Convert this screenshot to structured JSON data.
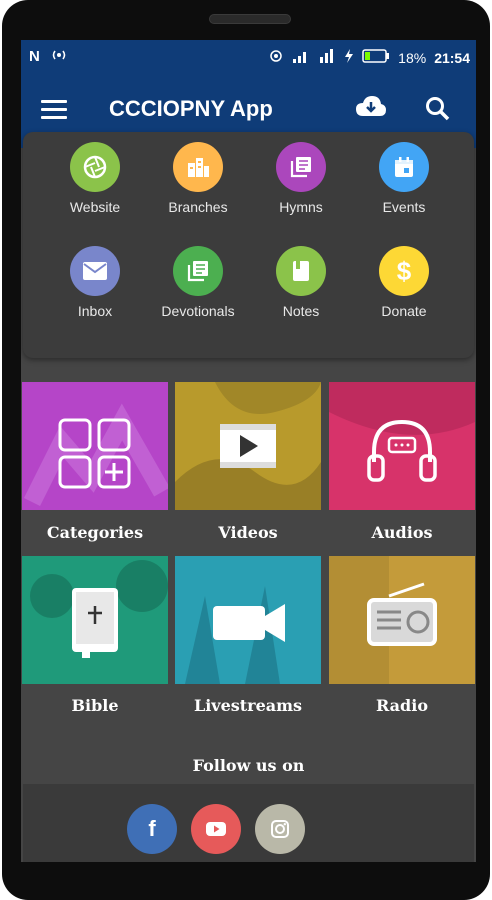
{
  "status_bar": {
    "left_icons": [
      "n-notification-icon",
      "radio-signal-icon"
    ],
    "right_icons": [
      "hotspot-icon",
      "signal-bars-icon",
      "mobile-data-icon",
      "charging-icon",
      "battery-icon"
    ],
    "battery": "18%",
    "time": "21:54"
  },
  "app_bar": {
    "title": "CCCIOPNY App",
    "icons": [
      "menu-icon",
      "cloud-download-icon",
      "search-icon"
    ]
  },
  "shortcuts": [
    {
      "label": "Website",
      "icon": "aperture-icon",
      "color": "#8bc34a"
    },
    {
      "label": "Branches",
      "icon": "city-icon",
      "color": "#ffb74d"
    },
    {
      "label": "Hymns",
      "icon": "library-books-icon",
      "color": "#ab47bc"
    },
    {
      "label": "Events",
      "icon": "calendar-icon",
      "color": "#42a5f5"
    },
    {
      "label": "Inbox",
      "icon": "mail-icon",
      "color": "#7986cb"
    },
    {
      "label": "Devotionals",
      "icon": "notes-list-icon",
      "color": "#4caf50"
    },
    {
      "label": "Notes",
      "icon": "book-icon",
      "color": "#8bc34a"
    },
    {
      "label": "Donate",
      "icon": "dollar-icon",
      "color": "#fdd835"
    }
  ],
  "tiles": [
    {
      "label": "Categories",
      "icon": "grid-plus-icon",
      "color": "#c34ad6"
    },
    {
      "label": "Videos",
      "icon": "video-player-icon",
      "color": "#b89a2c"
    },
    {
      "label": "Audios",
      "icon": "headphones-icon",
      "color": "#d7336a"
    },
    {
      "label": "Bible",
      "icon": "bible-icon",
      "color": "#1f9a7a"
    },
    {
      "label": "Livestreams",
      "icon": "video-camera-icon",
      "color": "#2a9fb3"
    },
    {
      "label": "Radio",
      "icon": "radio-icon",
      "color": "#c49b3a"
    }
  ],
  "follow": {
    "heading": "Follow us on",
    "socials": [
      {
        "name": "facebook",
        "icon": "facebook-icon",
        "glyph": "f",
        "color": "#3f6fb6"
      },
      {
        "name": "youtube",
        "icon": "youtube-icon",
        "color": "#e65a5a"
      },
      {
        "name": "instagram",
        "icon": "instagram-icon",
        "color": "#b9b8a8"
      }
    ]
  }
}
